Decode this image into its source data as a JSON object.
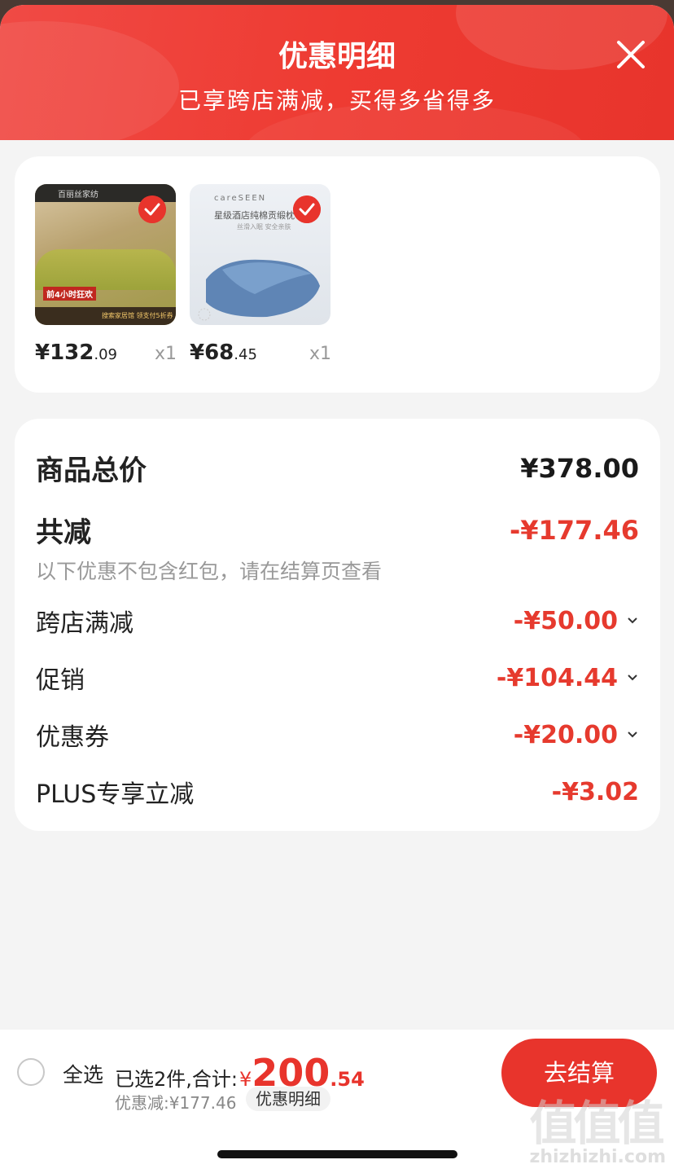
{
  "header": {
    "title": "优惠明细",
    "subtitle": "已享跨店满减，买得多省得多"
  },
  "products": [
    {
      "price_int": "¥132",
      "price_dec": ".09",
      "qty": "x1",
      "thumb_text_top": "百丽丝家纺",
      "thumb_text_banner": "前4小时狂欢",
      "thumb_text_bottom": "搜索家居馆 领支付5折券"
    },
    {
      "price_int": "¥68",
      "price_dec": ".45",
      "qty": "x1",
      "thumb_text_brand": "careSEEN",
      "thumb_text_title": "星级酒店纯棉贡缎枕",
      "thumb_text_sub": "丝滑入眠  安全亲肤"
    }
  ],
  "summary": {
    "total_label": "商品总价",
    "total_value": "¥378.00",
    "discount_label": "共减",
    "discount_value": "-¥177.46",
    "note": "以下优惠不包含红包，请在结算页查看",
    "items": [
      {
        "label": "跨店满减",
        "value": "-¥50.00",
        "expandable": true
      },
      {
        "label": "促销",
        "value": "-¥104.44",
        "expandable": true
      },
      {
        "label": "优惠券",
        "value": "-¥20.00",
        "expandable": true
      },
      {
        "label": "PLUS专享立减",
        "value": "-¥3.02",
        "expandable": false
      }
    ]
  },
  "bottom": {
    "select_all": "全选",
    "selected_text": "已选2件,合计:",
    "yen": "¥",
    "total_int": "200",
    "total_dec": ".54",
    "discount_text": "优惠减:¥177.46",
    "detail_link": "优惠明细",
    "checkout": "去结算"
  },
  "watermark": {
    "mark": "值值值",
    "site": "zhizhizhi.com"
  },
  "colors": {
    "accent": "#e8342c",
    "background": "#f4f4f4"
  }
}
